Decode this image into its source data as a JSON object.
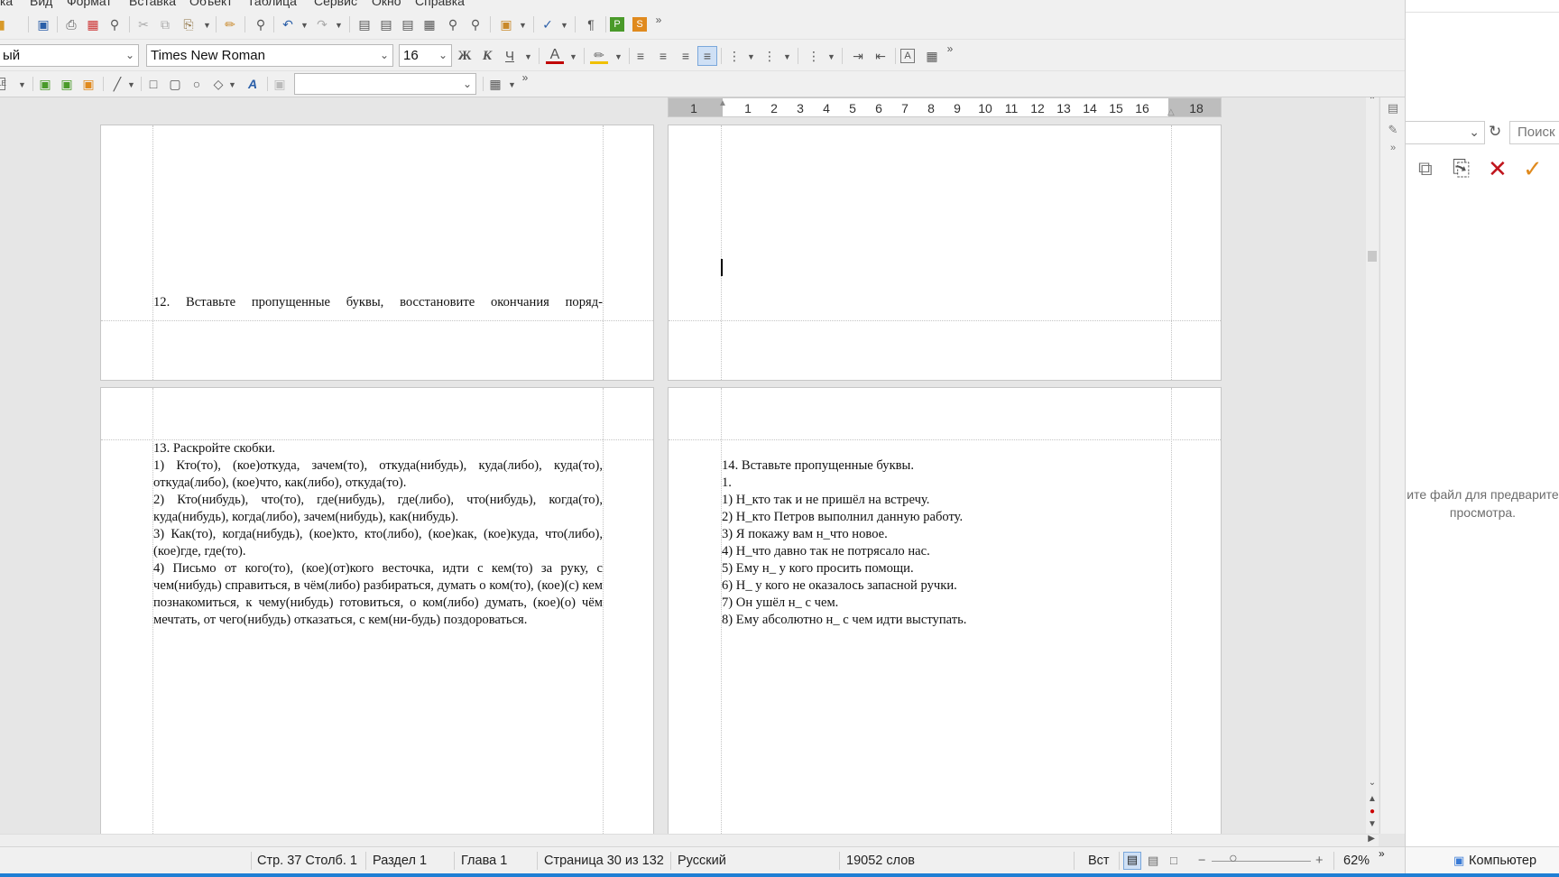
{
  "menu": [
    "ка",
    "Вид",
    "Формат",
    "Вставка",
    "Объект",
    "Таблица",
    "Сервис",
    "Окно",
    "Справка"
  ],
  "formatting": {
    "paragraph_style": "ый",
    "font_name": "Times New Roman",
    "font_size": "16",
    "bold_label": "Ж",
    "italic_label": "К",
    "underline_label": "Ч",
    "font_color_label": "A",
    "font_color": "#c00000",
    "highlight_color": "#f0c000"
  },
  "ruler": {
    "ticks": [
      "1",
      "1",
      "2",
      "3",
      "4",
      "5",
      "6",
      "7",
      "8",
      "9",
      "10",
      "11",
      "12",
      "13",
      "14",
      "15",
      "16",
      "18"
    ]
  },
  "pages": {
    "p1": {
      "line": "12. Вставьте пропущенные буквы, восстановите окончания поряд-"
    },
    "p3": {
      "heading": "13. Раскройте скобки.",
      "paragraphs": [
        "1) Кто(то), (кое)откуда, зачем(то), откуда(нибудь), куда(либо), куда(то), откуда(либо), (кое)что, как(либо), откуда(то).",
        "2) Кто(нибудь), что(то), где(нибудь), где(либо), что(нибудь), когда(то), куда(нибудь), когда(либо), зачем(нибудь), как(нибудь).",
        "3) Как(то), когда(нибудь), (кое)кто, кто(либо), (кое)как, (кое)куда, что(либо), (кое)где, где(то).",
        "4) Письмо от кого(то), (кое)(от)кого весточка, идти с кем(то) за руку, с чем(нибудь) справиться, в чём(либо) разбираться, думать о ком(то), (кое)(с) кем познакомиться, к чему(нибудь) готовиться, о ком(либо) думать, (кое)(о) чём мечтать, от чего(нибудь) отказаться, с кем(ни-будь) поздороваться."
      ]
    },
    "p4": {
      "heading": "14. Вставьте пропущенные буквы.",
      "lines": [
        "1.",
        "1) Н_кто так и не пришёл на встречу.",
        "2) Н_кто Петров выполнил данную работу.",
        "3) Я покажу вам н_что новое.",
        "4) Н_что давно так не потрясало нас.",
        "5) Ему н_ у кого просить помощи.",
        "6) Н_ у кого не оказалось запасной ручки.",
        "7) Он ушёл н_ с чем.",
        "8) Ему абсолютно н_ с чем идти выступать."
      ]
    }
  },
  "status": {
    "page_col": "Стр. 37 Столб. 1",
    "section": "Раздел 1",
    "chapter": "Глава 1",
    "page_of": "Страница 30 из 132",
    "language": "Русский",
    "word_count": "19052 слов",
    "insert_mode": "Вст",
    "zoom": "62%"
  },
  "explorer": {
    "search_placeholder": "Поиск",
    "preview_message": "ите файл для предварите\nпросмотра.",
    "status_label": "Компьютер"
  }
}
